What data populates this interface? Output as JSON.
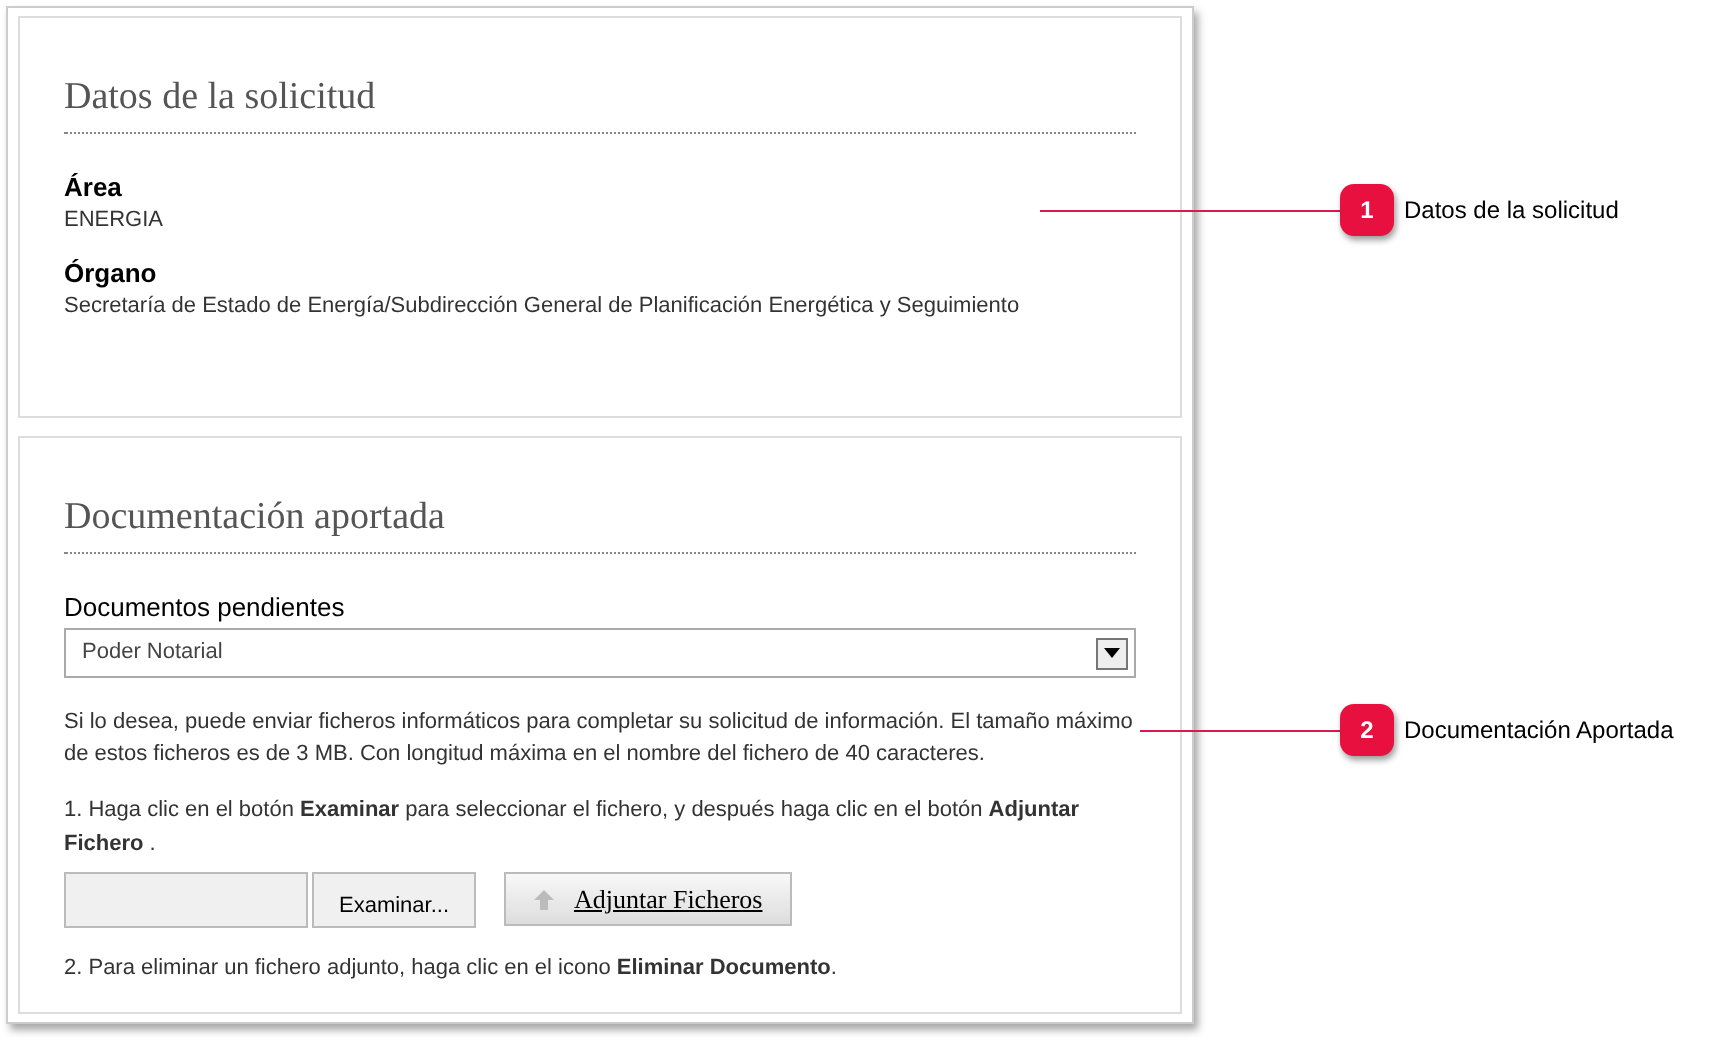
{
  "datos": {
    "title": "Datos de la solicitud",
    "fields": [
      {
        "label": "Área",
        "value": "ENERGIA"
      },
      {
        "label": "Órgano",
        "value": "Secretaría de Estado de Energía/Subdirección General de Planificación Energética y Seguimiento"
      }
    ]
  },
  "documentacion": {
    "title": "Documentación aportada",
    "select": {
      "label": "Documentos pendientes",
      "value": "Poder Notarial"
    },
    "intro": "Si lo desea, puede enviar ficheros informáticos para completar su solicitud de información. El tamaño máximo de estos ficheros es de 3 MB. Con longitud máxima en el nombre del fichero de 40 caracteres.",
    "step_1": "1. Haga clic en el botón **Examinar** para seleccionar el fichero, y después haga clic en el botón **Adjuntar Fichero** .",
    "browse_button": "Examinar...",
    "attach_button": "Adjuntar Ficheros",
    "step_2": "2. Para eliminar un fichero adjunto, haga clic en el icono **Eliminar Documento**."
  },
  "callouts": [
    {
      "number": "1",
      "label": "Datos de la solicitud"
    },
    {
      "number": "2",
      "label": "Documentación Aportada"
    }
  ]
}
